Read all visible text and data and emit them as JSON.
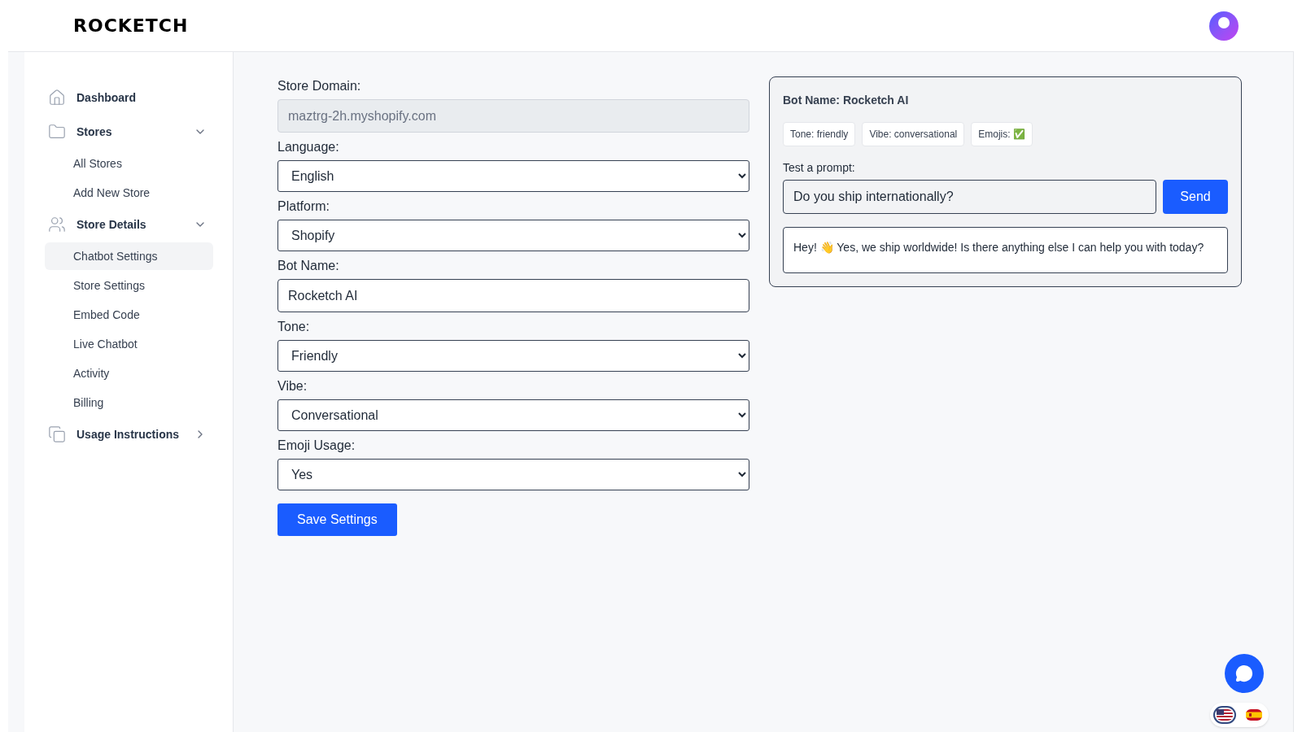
{
  "header": {
    "logo": "ROCKETCH"
  },
  "sidebar": {
    "items": [
      {
        "label": "Dashboard",
        "kind": "home",
        "selected": false
      },
      {
        "label": "Stores",
        "kind": "folder",
        "expanded": true,
        "children": [
          {
            "label": "All Stores",
            "selected": false
          },
          {
            "label": "Add New Store",
            "selected": false
          }
        ]
      },
      {
        "label": "Store Details",
        "kind": "people",
        "expanded": true,
        "children": [
          {
            "label": "Chatbot Settings",
            "selected": true
          },
          {
            "label": "Store Settings",
            "selected": false
          },
          {
            "label": "Embed Code",
            "selected": false
          },
          {
            "label": "Live Chatbot",
            "selected": false
          },
          {
            "label": "Activity",
            "selected": false
          },
          {
            "label": "Billing",
            "selected": false
          }
        ]
      },
      {
        "label": "Usage Instructions",
        "kind": "copy",
        "expanded": false
      }
    ]
  },
  "form": {
    "fields": [
      {
        "label": "Store Domain:",
        "kind": "input",
        "value": "maztrg-2h.myshopify.com",
        "disabled": true
      },
      {
        "label": "Language:",
        "kind": "select",
        "value": "English"
      },
      {
        "label": "Platform:",
        "kind": "select",
        "value": "Shopify"
      },
      {
        "label": "Bot Name:",
        "kind": "input",
        "value": "Rocketch AI",
        "disabled": false
      },
      {
        "label": "Tone:",
        "kind": "select",
        "value": "Friendly"
      },
      {
        "label": "Vibe:",
        "kind": "select",
        "value": "Conversational"
      },
      {
        "label": "Emoji Usage:",
        "kind": "select",
        "value": "Yes"
      }
    ],
    "save_button": "Save Settings"
  },
  "preview": {
    "title": "Bot Name: Rocketch AI",
    "tags": [
      "Tone: friendly",
      "Vibe: conversational",
      "Emojis: ✅"
    ],
    "prompt_label": "Test a prompt:",
    "prompt_value": "Do you ship internationally?",
    "send_button": "Send",
    "response": "Hey! 👋 Yes, we ship worldwide! Is there anything else I can help you with today?"
  },
  "languages": [
    {
      "kind": "us",
      "selected": true
    },
    {
      "kind": "es",
      "selected": false
    }
  ]
}
